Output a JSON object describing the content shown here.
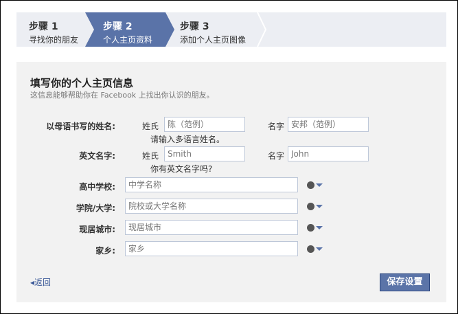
{
  "steps": [
    {
      "title": "步骤 1",
      "subtitle": "寻找你的朋友"
    },
    {
      "title": "步骤 2",
      "subtitle": "个人主页资料"
    },
    {
      "title": "步骤 3",
      "subtitle": "添加个人主页图像"
    }
  ],
  "form": {
    "title": "填写你的个人主页信息",
    "subtitle": "这信息能够帮助你在 Facebook 上找出你认识的朋友。",
    "native_name": {
      "label": "以母语书写的姓名:",
      "last_label": "姓氏",
      "last_placeholder": "陈（范例）",
      "first_label": "名字",
      "first_placeholder": "安邦（范例）",
      "hint": "请输入多语言姓名。"
    },
    "english_name": {
      "label": "英文名字:",
      "last_label": "姓氏",
      "last_placeholder": "Smith",
      "first_label": "名字",
      "first_placeholder": "John",
      "hint": "你有英文名字吗?"
    },
    "fields": [
      {
        "label": "高中学校:",
        "placeholder": "中学名称"
      },
      {
        "label": "学院/大学:",
        "placeholder": "院校或大学名称"
      },
      {
        "label": "现居城市:",
        "placeholder": "现居城市"
      },
      {
        "label": "家乡:",
        "placeholder": "家乡"
      }
    ],
    "back_label": "返回",
    "save_label": "保存设置"
  }
}
